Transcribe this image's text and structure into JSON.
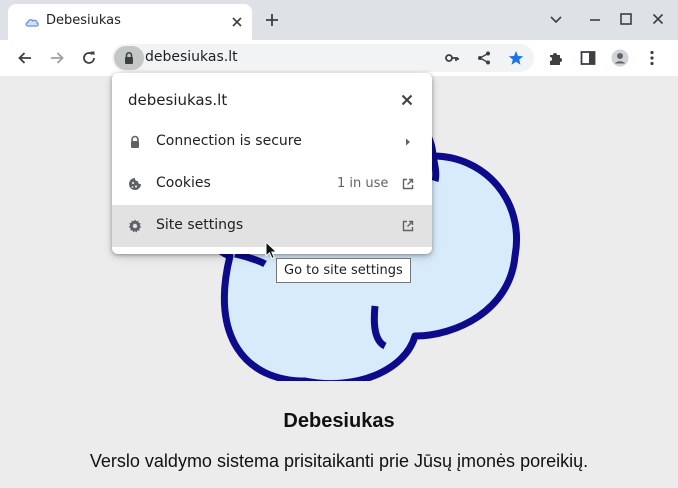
{
  "browser": {
    "tab": {
      "title": "Debesiukas"
    },
    "url": "debesiukas.lt"
  },
  "popup": {
    "domain": "debesiukas.lt",
    "rows": [
      {
        "icon": "lock-icon",
        "label": "Connection is secure"
      },
      {
        "icon": "cookie-icon",
        "label": "Cookies",
        "meta": "1 in use"
      },
      {
        "icon": "gear-icon",
        "label": "Site settings"
      }
    ],
    "tooltip": "Go to site settings"
  },
  "page": {
    "heading": "Debesiukas",
    "tagline": "Verslo valdymo sistema prisitaikanti prie Jūsų įmonės poreikių."
  },
  "colors": {
    "cloud_fill": "#d8ebfa",
    "cloud_stroke": "#0d0a8c",
    "bookmark_star": "#1a73e8"
  }
}
